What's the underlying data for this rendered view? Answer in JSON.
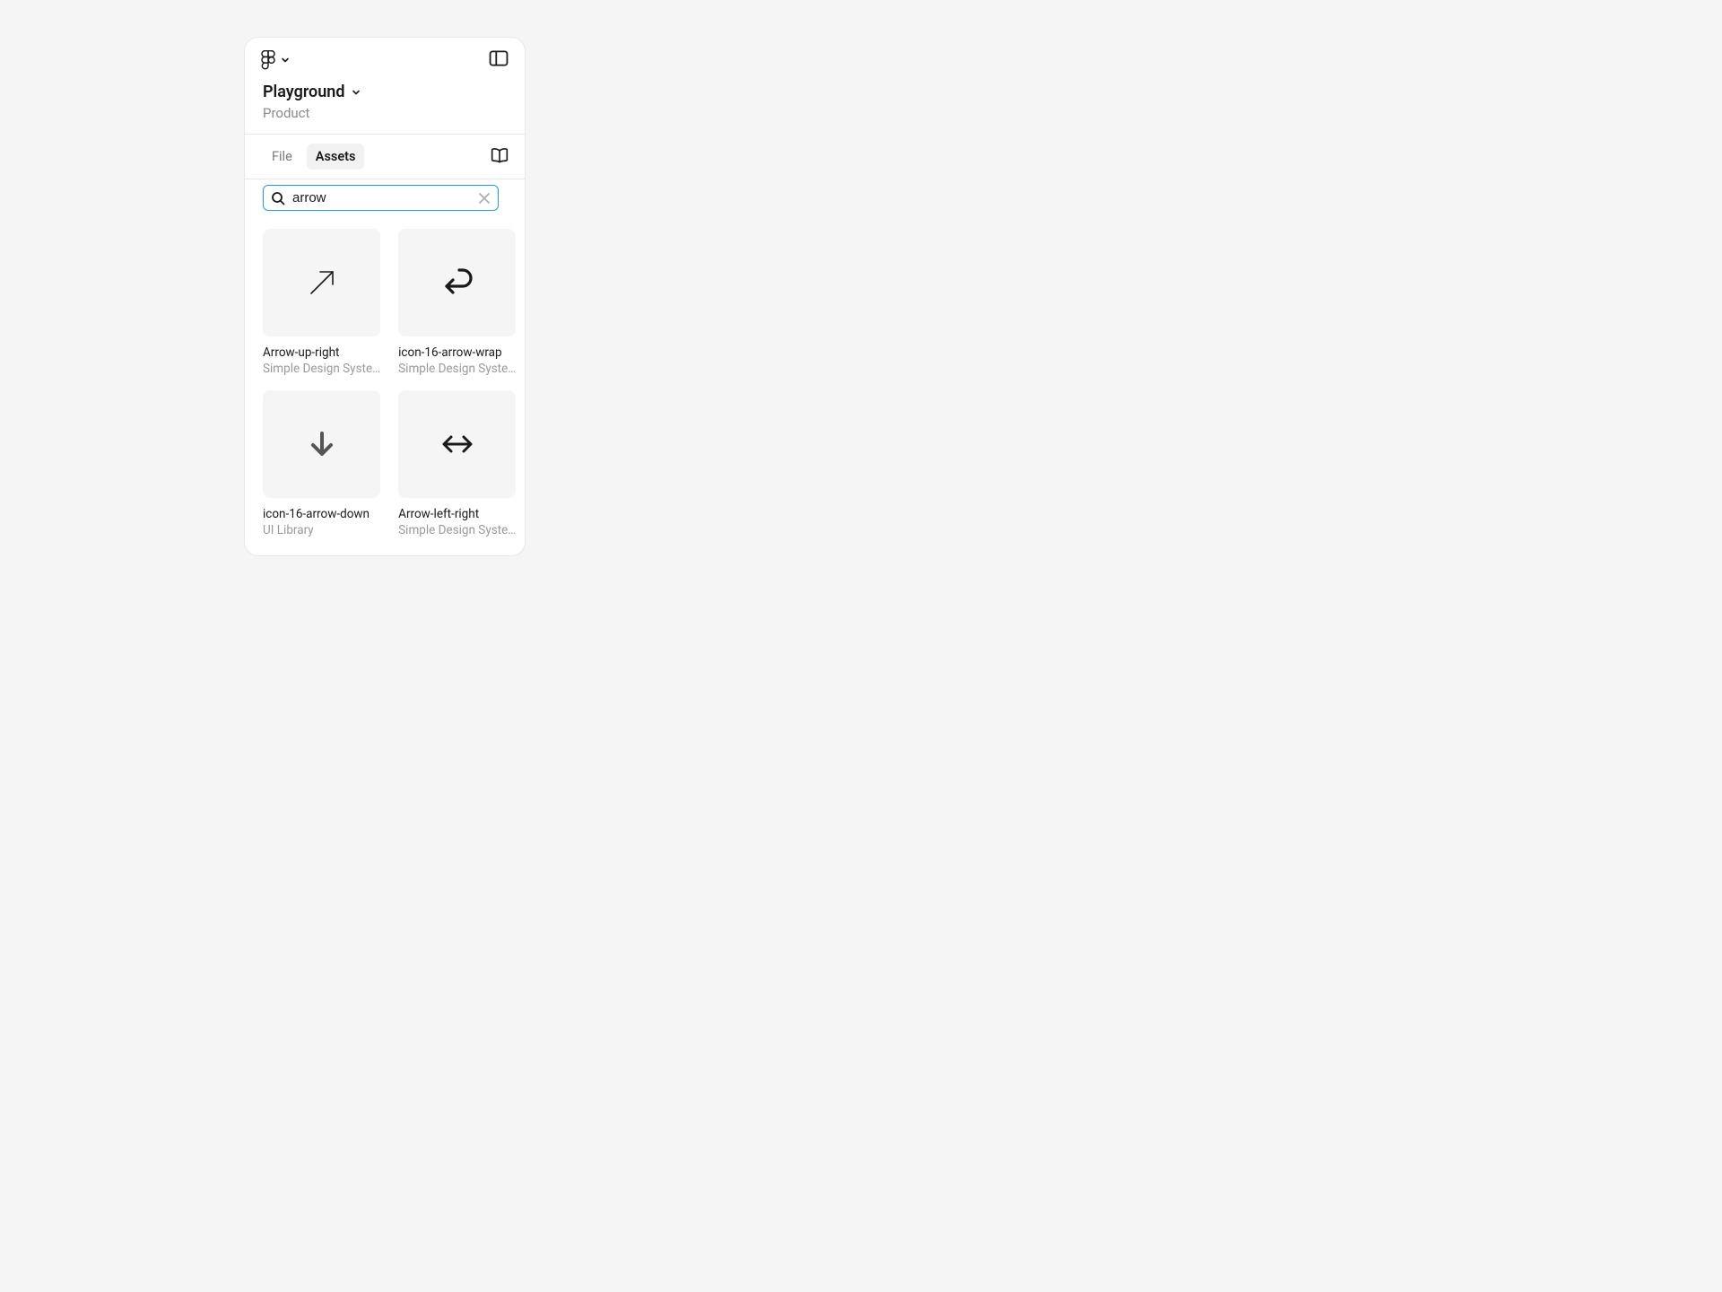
{
  "header": {
    "file_title": "Playground",
    "file_subtitle": "Product"
  },
  "tabs": {
    "file": "File",
    "assets": "Assets"
  },
  "search": {
    "value": "arrow"
  },
  "assets": [
    {
      "name": "Arrow-up-right",
      "library": "Simple Design Syste…",
      "icon": "arrow-up-right"
    },
    {
      "name": "icon-16-arrow-wrap",
      "library": "Simple Design Syste…",
      "icon": "arrow-wrap"
    },
    {
      "name": "icon-16-arrow-down",
      "library": "UI Library",
      "icon": "arrow-down"
    },
    {
      "name": "Arrow-left-right",
      "library": "Simple Design Syste…",
      "icon": "arrow-left-right"
    }
  ]
}
